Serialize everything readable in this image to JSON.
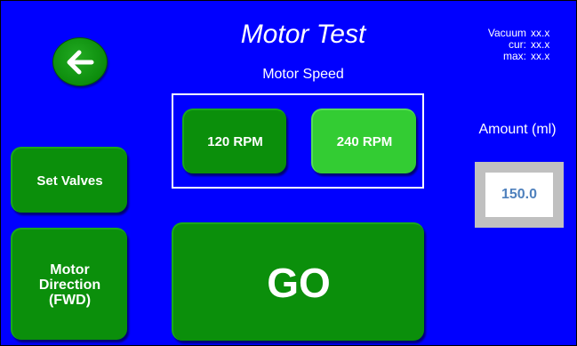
{
  "header": {
    "title": "Motor Test",
    "subtitle": "Motor Speed"
  },
  "readout": {
    "vacuum_label": "Vacuum",
    "vacuum_value": "xx.x",
    "cur_label": "cur:",
    "cur_value": "xx.x",
    "max_label": "max:",
    "max_value": "xx.x"
  },
  "speed": {
    "option_120": "120 RPM",
    "option_240": "240 RPM",
    "selected": "240 RPM"
  },
  "buttons": {
    "set_valves": "Set Valves",
    "direction_line1": "Motor",
    "direction_line2": "Direction",
    "direction_line3": "(FWD)",
    "go": "GO",
    "back_icon": "arrow-left-icon"
  },
  "amount": {
    "label": "Amount (ml)",
    "value": "150.0"
  },
  "colors": {
    "background": "#0000ff",
    "button_green": "#0b8f0b",
    "button_selected": "#33cc33",
    "value_text": "#4f81bd"
  }
}
